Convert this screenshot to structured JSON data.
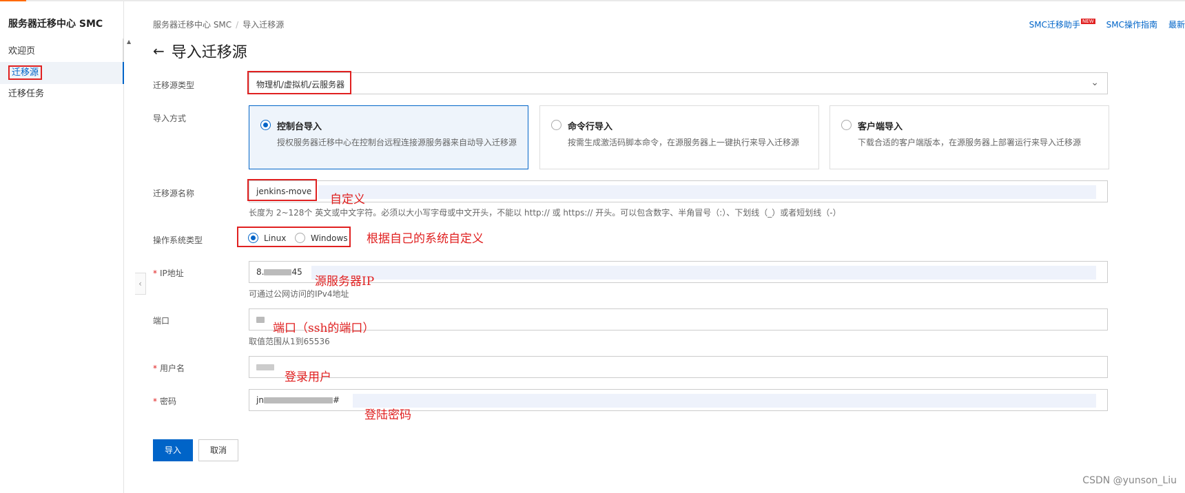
{
  "sidebar": {
    "title": "服务器迁移中心 SMC",
    "items": [
      {
        "label": "欢迎页"
      },
      {
        "label": "迁移源"
      },
      {
        "label": "迁移任务"
      }
    ]
  },
  "header": {
    "breadcrumb": [
      "服务器迁移中心 SMC",
      "导入迁移源"
    ],
    "title": "导入迁移源",
    "links": [
      "SMC迁移助手",
      "SMC操作指南",
      "最新"
    ],
    "new_badge": "NEW"
  },
  "form": {
    "source_type": {
      "label": "迁移源类型",
      "value": "物理机/虚拟机/云服务器"
    },
    "import_method": {
      "label": "导入方式",
      "options": [
        {
          "title": "控制台导入",
          "desc": "授权服务器迁移中心在控制台远程连接源服务器来自动导入迁移源",
          "selected": true
        },
        {
          "title": "命令行导入",
          "desc": "按需生成激活码脚本命令，在源服务器上一键执行来导入迁移源",
          "selected": false
        },
        {
          "title": "客户端导入",
          "desc": "下载合适的客户端版本，在源服务器上部署运行来导入迁移源",
          "selected": false
        }
      ]
    },
    "source_name": {
      "label": "迁移源名称",
      "value": "jenkins-move",
      "help": "长度为 2~128个 英文或中文字符。必须以大小写字母或中文开头，不能以 http:// 或 https:// 开头。可以包含数字、半角冒号（:）、下划线（_）或者短划线（-）"
    },
    "os_type": {
      "label": "操作系统类型",
      "options": [
        {
          "label": "Linux",
          "selected": true
        },
        {
          "label": "Windows",
          "selected": false
        }
      ]
    },
    "ip": {
      "label": "IP地址",
      "value_prefix": "8.",
      "value_suffix": "45",
      "help": "可通过公网访问的IPv4地址"
    },
    "port": {
      "label": "端口",
      "help": "取值范围从1到65536"
    },
    "username": {
      "label": "用户名"
    },
    "password": {
      "label": "密码",
      "value_prefix": "jn",
      "value_suffix": "#"
    },
    "submit_label": "导入",
    "cancel_label": "取消"
  },
  "annotations": {
    "custom": "自定义",
    "os_custom": "根据自己的系统自定义",
    "source_ip": "源服务器IP",
    "port": "端口（ssh的端口）",
    "login_user": "登录用户",
    "login_pwd": "登陆密码"
  },
  "watermark": "CSDN @yunson_Liu",
  "colors": {
    "primary": "#0064c8",
    "annotation": "#e02020",
    "accent": "#ff6a00"
  }
}
